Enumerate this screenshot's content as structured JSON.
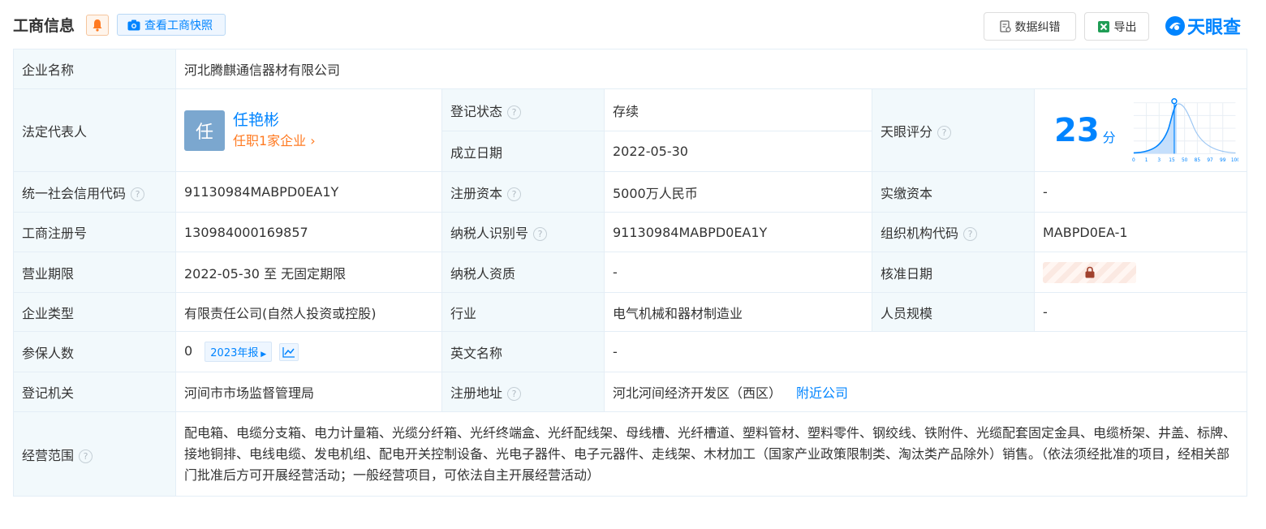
{
  "header": {
    "title": "工商信息",
    "snapshot_label": "查看工商快照",
    "correct_label": "数据纠错",
    "export_label": "导出",
    "logo_text": "天眼查"
  },
  "labels": {
    "company_name": "企业名称",
    "legal_rep": "法定代表人",
    "reg_status": "登记状态",
    "established": "成立日期",
    "tianyan_score": "天眼评分",
    "credit_code": "统一社会信用代码",
    "reg_capital": "注册资本",
    "paid_capital": "实缴资本",
    "reg_number": "工商注册号",
    "taxpayer_id": "纳税人识别号",
    "org_code": "组织机构代码",
    "business_term": "营业期限",
    "taxpayer_qual": "纳税人资质",
    "approval_date": "核准日期",
    "company_type": "企业类型",
    "industry": "行业",
    "staff_size": "人员规模",
    "insured": "参保人数",
    "english_name": "英文名称",
    "reg_authority": "登记机关",
    "reg_address": "注册地址",
    "business_scope": "经营范围"
  },
  "values": {
    "company_name": "河北腾麒通信器材有限公司",
    "rep_avatar": "任",
    "rep_name": "任艳彬",
    "rep_positions": "任职1家企业",
    "reg_status": "存续",
    "established": "2022-05-30",
    "score": "23",
    "score_unit": "分",
    "credit_code": "91130984MABPD0EA1Y",
    "reg_capital": "5000万人民币",
    "paid_capital": "-",
    "reg_number": "130984000169857",
    "taxpayer_id": "91130984MABPD0EA1Y",
    "org_code": "MABPD0EA-1",
    "business_term": "2022-05-30 至 无固定期限",
    "taxpayer_qual": "-",
    "company_type": "有限责任公司(自然人投资或控股)",
    "industry": "电气机械和器材制造业",
    "staff_size": "-",
    "insured": "0",
    "insured_tag": "2023年报",
    "english_name": "-",
    "reg_authority": "河间市市场监督管理局",
    "reg_address": "河北河间经济开发区（西区）",
    "nearby": "附近公司",
    "business_scope": "配电箱、电缆分支箱、电力计量箱、光缆分纤箱、光纤终端盒、光纤配线架、母线槽、光纤槽道、塑料管材、塑料零件、钢绞线、铁附件、光缆配套固定金具、电缆桥架、井盖、标牌、接地铜排、电线电缆、发电机组、配电开关控制设备、光电子器件、电子元器件、走线架、木材加工（国家产业政策限制类、淘汰类产品除外）销售。（依法须经批准的项目，经相关部门批准后方可开展经营活动；一般经营项目，可依法自主开展经营活动）"
  },
  "score_chart": {
    "ticks": [
      "0",
      "1",
      "3",
      "15",
      "50",
      "85",
      "97",
      "99",
      "100"
    ]
  },
  "colors": {
    "accent": "#0084ff",
    "status_green": "#1ea54a",
    "orange": "#ff7a21",
    "label_bg": "#f2f9fc"
  }
}
